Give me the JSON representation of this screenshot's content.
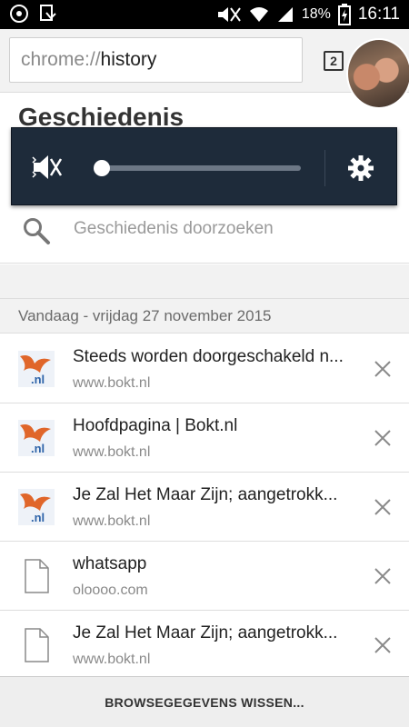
{
  "status_bar": {
    "battery_percent": "18%",
    "time": "16:11"
  },
  "omnibox": {
    "scheme": "chrome://",
    "host": "history"
  },
  "tab_count": "2",
  "page": {
    "title": "Geschiedenis"
  },
  "volume_panel": {
    "level": 0.0
  },
  "search": {
    "placeholder": "Geschiedenis doorzoeken"
  },
  "date_header": "Vandaag - vrijdag 27 november 2015",
  "entries": [
    {
      "title": "Steeds worden doorgeschakeld n...",
      "domain": "www.bokt.nl",
      "favicon": "bokt-favicon"
    },
    {
      "title": "Hoofdpagina | Bokt.nl",
      "domain": "www.bokt.nl",
      "favicon": "bokt-favicon"
    },
    {
      "title": "Je Zal Het Maar Zijn; aangetrokk...",
      "domain": "www.bokt.nl",
      "favicon": "bokt-favicon"
    },
    {
      "title": "whatsapp",
      "domain": "oloooo.com",
      "favicon": "page-icon"
    },
    {
      "title": "Je Zal Het Maar Zijn; aangetrokk...",
      "domain": "www.bokt.nl",
      "favicon": "page-icon"
    }
  ],
  "clear_button": "BROWSEGEGEVENS WISSEN...",
  "colors": {
    "volume_panel_bg": "#1e2b3a",
    "bokt_orange": "#e0662a",
    "bokt_blue": "#2d63a8"
  }
}
